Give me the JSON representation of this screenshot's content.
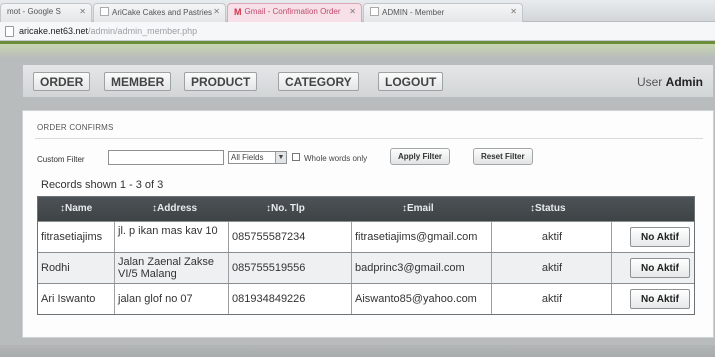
{
  "browser": {
    "tabs": [
      {
        "label": "mot - Google S"
      },
      {
        "label": "AriCake Cakes and Pastries"
      },
      {
        "label": "Gmail - Confirmation Order"
      },
      {
        "label": "ADMIN - Member"
      }
    ],
    "url_host": "aricake.net63.net",
    "url_path": "/admin/admin_member.php"
  },
  "nav": {
    "items": [
      "ORDER",
      "MEMBER",
      "PRODUCT",
      "CATEGORY",
      "LOGOUT"
    ],
    "user_label": "User",
    "user_name": "Admin"
  },
  "panel": {
    "title": "ORDER CONFIRMS",
    "filter": {
      "label": "Custom Filter",
      "value": "",
      "select_value": "All Fields",
      "whole_words_label": "Whole words only",
      "apply_label": "Apply Filter",
      "reset_label": "Reset Filter"
    },
    "records_text": "Records shown 1 - 3 of 3"
  },
  "table": {
    "headers": [
      "↕Name",
      "↕Address",
      "↕No. Tlp",
      "↕Email",
      "↕Status"
    ],
    "rows": [
      {
        "name": "fitrasetiajims",
        "address": "jl. p ikan mas kav 10",
        "phone": "085755587234",
        "email": "fitrasetiajims@gmail.com",
        "status": "aktif",
        "action": "No Aktif"
      },
      {
        "name": "Rodhi",
        "address": "Jalan Zaenal Zakse VI/5 Malang",
        "phone": "085755519556",
        "email": "badprinc3@gmail.com",
        "status": "aktif",
        "action": "No Aktif"
      },
      {
        "name": "Ari Iswanto",
        "address": "jalan glof no 07",
        "phone": "081934849226",
        "email": "Aiswanto85@yahoo.com",
        "status": "aktif",
        "action": "No Aktif"
      }
    ]
  },
  "colors": {
    "header_bg": "#44494c",
    "accent_green": "#6a8e3c",
    "gmail_red": "#c04a6e"
  }
}
